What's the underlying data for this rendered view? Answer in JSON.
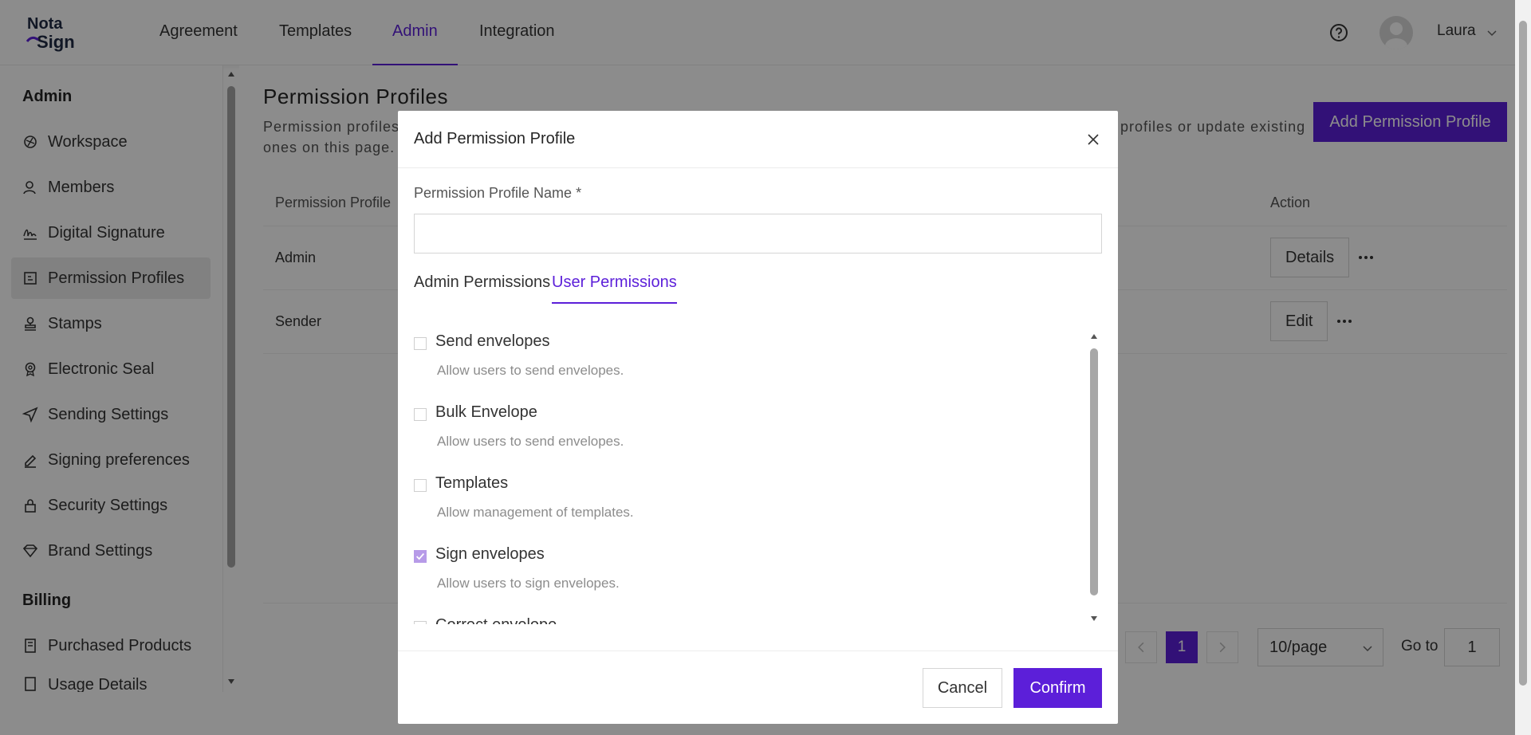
{
  "brand": {
    "logo_line1": "Nota",
    "logo_line2": "Sign",
    "accent": "#5c1fd9"
  },
  "nav": {
    "items": [
      {
        "label": "Agreement"
      },
      {
        "label": "Templates"
      },
      {
        "label": "Admin",
        "active": true
      },
      {
        "label": "Integration"
      }
    ],
    "user_name": "Laura",
    "help_icon": "help-circle-icon"
  },
  "sidebar": {
    "group_admin": "Admin",
    "items": [
      {
        "label": "Workspace",
        "icon": "workspace-icon"
      },
      {
        "label": "Members",
        "icon": "members-icon"
      },
      {
        "label": "Digital Signature",
        "icon": "signature-icon"
      },
      {
        "label": "Permission Profiles",
        "icon": "permission-icon",
        "active": true
      },
      {
        "label": "Stamps",
        "icon": "stamp-icon"
      },
      {
        "label": "Electronic Seal",
        "icon": "seal-icon"
      },
      {
        "label": "Sending Settings",
        "icon": "send-icon"
      },
      {
        "label": "Signing preferences",
        "icon": "pen-icon"
      },
      {
        "label": "Security Settings",
        "icon": "lock-icon"
      },
      {
        "label": "Brand Settings",
        "icon": "brand-icon"
      }
    ],
    "group_billing": "Billing",
    "billing_items": [
      {
        "label": "Purchased Products",
        "icon": "purchase-icon"
      },
      {
        "label": "Usage Details",
        "icon": "usage-icon"
      }
    ]
  },
  "page": {
    "title": "Permission Profiles",
    "desc_left": "Permission profiles",
    "desc_right": "profiles or update existing",
    "desc_line2": "ones on this page.",
    "add_button": "Add Permission Profile"
  },
  "table": {
    "headers": {
      "profile": "Permission Profile",
      "action": "Action"
    },
    "rows": [
      {
        "name": "Admin",
        "action": "Details"
      },
      {
        "name": "Sender",
        "action": "Edit"
      }
    ]
  },
  "pagination": {
    "current_page": "1",
    "page_size": "10/page",
    "goto_label": "Go to",
    "goto_value": "1"
  },
  "modal": {
    "title": "Add Permission Profile",
    "name_label": "Permission Profile Name *",
    "name_value": "",
    "tabs": [
      {
        "label": "Admin Permissions"
      },
      {
        "label": "User Permissions",
        "active": true
      }
    ],
    "permissions": [
      {
        "name": "Send envelopes",
        "desc": "Allow users to send envelopes.",
        "checked": false
      },
      {
        "name": "Bulk Envelope",
        "desc": "Allow users to send envelopes.",
        "checked": false
      },
      {
        "name": "Templates",
        "desc": "Allow management of templates.",
        "checked": false
      },
      {
        "name": "Sign envelopes",
        "desc": "Allow users to sign envelopes.",
        "checked": true
      },
      {
        "name": "Correct envelope",
        "desc": "",
        "checked": false
      }
    ],
    "cancel": "Cancel",
    "confirm": "Confirm"
  }
}
